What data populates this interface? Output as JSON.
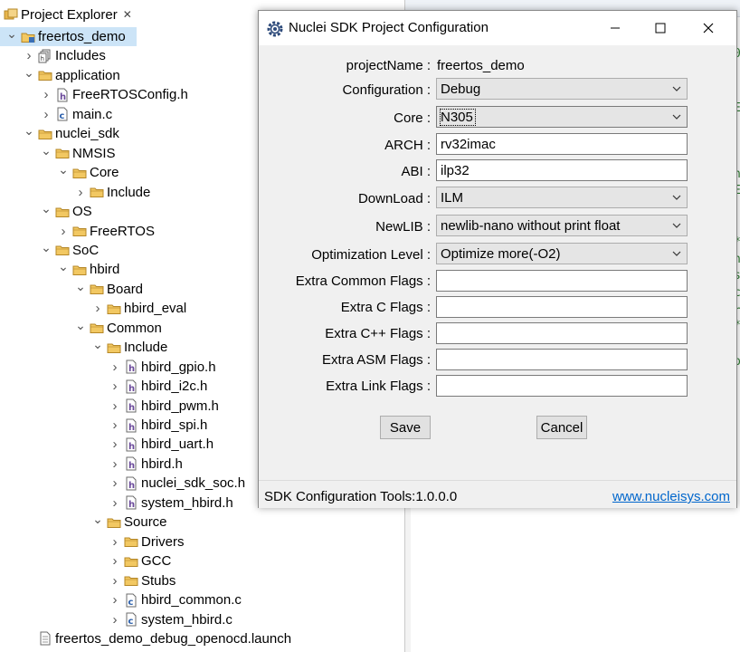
{
  "explorer": {
    "title": "Project Explorer",
    "tree": [
      {
        "label": "freertos_demo",
        "depth": 0,
        "twisty": "open",
        "icon": "project",
        "selected": true
      },
      {
        "label": "Includes",
        "depth": 1,
        "twisty": "closed",
        "icon": "includes"
      },
      {
        "label": "application",
        "depth": 1,
        "twisty": "open",
        "icon": "folder"
      },
      {
        "label": "FreeRTOSConfig.h",
        "depth": 2,
        "twisty": "closed",
        "icon": "h-file"
      },
      {
        "label": "main.c",
        "depth": 2,
        "twisty": "closed",
        "icon": "c-file"
      },
      {
        "label": "nuclei_sdk",
        "depth": 1,
        "twisty": "open",
        "icon": "folder"
      },
      {
        "label": "NMSIS",
        "depth": 2,
        "twisty": "open",
        "icon": "folder"
      },
      {
        "label": "Core",
        "depth": 3,
        "twisty": "open",
        "icon": "folder"
      },
      {
        "label": "Include",
        "depth": 4,
        "twisty": "closed",
        "icon": "folder"
      },
      {
        "label": "OS",
        "depth": 2,
        "twisty": "open",
        "icon": "folder"
      },
      {
        "label": "FreeRTOS",
        "depth": 3,
        "twisty": "closed",
        "icon": "folder"
      },
      {
        "label": "SoC",
        "depth": 2,
        "twisty": "open",
        "icon": "folder"
      },
      {
        "label": "hbird",
        "depth": 3,
        "twisty": "open",
        "icon": "folder"
      },
      {
        "label": "Board",
        "depth": 4,
        "twisty": "open",
        "icon": "folder"
      },
      {
        "label": "hbird_eval",
        "depth": 5,
        "twisty": "closed",
        "icon": "folder"
      },
      {
        "label": "Common",
        "depth": 4,
        "twisty": "open",
        "icon": "folder"
      },
      {
        "label": "Include",
        "depth": 5,
        "twisty": "open",
        "icon": "folder"
      },
      {
        "label": "hbird_gpio.h",
        "depth": 6,
        "twisty": "closed",
        "icon": "h-file"
      },
      {
        "label": "hbird_i2c.h",
        "depth": 6,
        "twisty": "closed",
        "icon": "h-file"
      },
      {
        "label": "hbird_pwm.h",
        "depth": 6,
        "twisty": "closed",
        "icon": "h-file"
      },
      {
        "label": "hbird_spi.h",
        "depth": 6,
        "twisty": "closed",
        "icon": "h-file"
      },
      {
        "label": "hbird_uart.h",
        "depth": 6,
        "twisty": "closed",
        "icon": "h-file"
      },
      {
        "label": "hbird.h",
        "depth": 6,
        "twisty": "closed",
        "icon": "h-file"
      },
      {
        "label": "nuclei_sdk_soc.h",
        "depth": 6,
        "twisty": "closed",
        "icon": "h-file"
      },
      {
        "label": "system_hbird.h",
        "depth": 6,
        "twisty": "closed",
        "icon": "h-file"
      },
      {
        "label": "Source",
        "depth": 5,
        "twisty": "open",
        "icon": "folder"
      },
      {
        "label": "Drivers",
        "depth": 6,
        "twisty": "closed",
        "icon": "folder"
      },
      {
        "label": "GCC",
        "depth": 6,
        "twisty": "closed",
        "icon": "folder"
      },
      {
        "label": "Stubs",
        "depth": 6,
        "twisty": "closed",
        "icon": "folder"
      },
      {
        "label": "hbird_common.c",
        "depth": 6,
        "twisty": "closed",
        "icon": "c-file"
      },
      {
        "label": "system_hbird.c",
        "depth": 6,
        "twisty": "closed",
        "icon": "c-file"
      },
      {
        "label": "freertos_demo_debug_openocd.launch",
        "depth": 1,
        "twisty": "none",
        "icon": "launch-file"
      }
    ]
  },
  "editor": {
    "fragments": [
      "0",
      "E",
      "n",
      "E",
      "*",
      "h",
      "s",
      "c",
      "r",
      "*",
      "p"
    ]
  },
  "dialog": {
    "title": "Nuclei SDK Project Configuration",
    "fields": {
      "projectName": {
        "label": "projectName :",
        "value": "freertos_demo"
      },
      "configuration": {
        "label": "Configuration :",
        "value": "Debug"
      },
      "core": {
        "label": "Core :",
        "value": "N305"
      },
      "arch": {
        "label": "ARCH :",
        "value": "rv32imac"
      },
      "abi": {
        "label": "ABI :",
        "value": "ilp32"
      },
      "download": {
        "label": "DownLoad :",
        "value": "ILM"
      },
      "newlib": {
        "label": "NewLIB :",
        "value": "newlib-nano without print float"
      },
      "optimization": {
        "label": "Optimization Level :",
        "value": "Optimize more(-O2)"
      },
      "common_flags": {
        "label": "Extra Common Flags :",
        "value": ""
      },
      "c_flags": {
        "label": "Extra C Flags :",
        "value": ""
      },
      "cpp_flags": {
        "label": "Extra C++ Flags :",
        "value": ""
      },
      "asm_flags": {
        "label": "Extra ASM Flags :",
        "value": ""
      },
      "link_flags": {
        "label": "Extra Link Flags :",
        "value": ""
      }
    },
    "save_label": "Save",
    "cancel_label": "Cancel",
    "status_text": "SDK Configuration Tools:1.0.0.0",
    "status_link": "www.nucleisys.com"
  },
  "colors": {
    "accent": "#0066cc",
    "selection": "#cce4f7",
    "folder": "#e8b64c"
  }
}
